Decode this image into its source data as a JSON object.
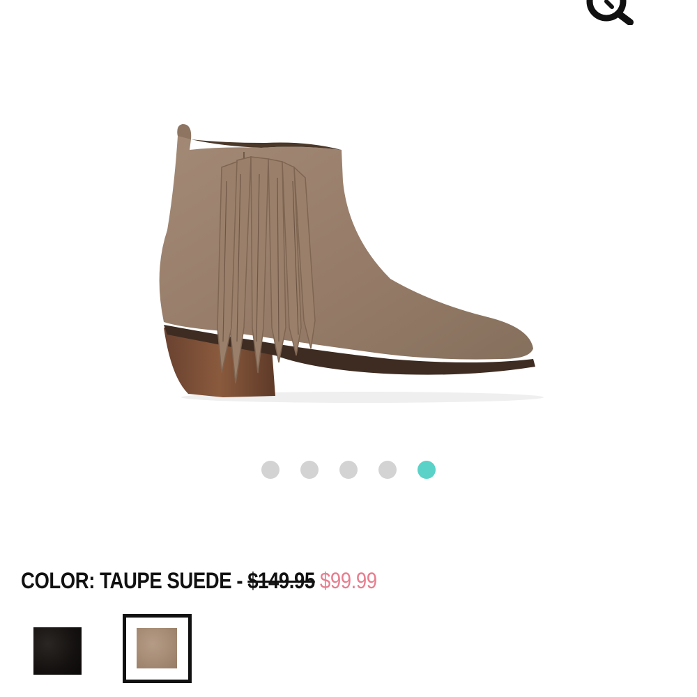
{
  "header": {
    "zoom_icon": "zoom-magnifier-icon"
  },
  "product": {
    "image_alt": "Taupe suede fringe ankle boot",
    "colors": {
      "suede": "#9c8370",
      "sole": "#4a352a",
      "heel": "#7a4e34"
    }
  },
  "carousel": {
    "dot_count": 5,
    "active_index": 4,
    "dot_color": "#d3d3d3",
    "active_color": "#5ad2c8"
  },
  "color_info": {
    "prefix": "COLOR: TAUPE SUEDE - ",
    "original_price": "$149.95",
    "sale_price": "$99.99",
    "sale_color": "#e87d8e"
  },
  "swatches": [
    {
      "name": "Black",
      "color": "#141110",
      "selected": false
    },
    {
      "name": "Taupe Suede",
      "color": "#a68b74",
      "selected": true
    }
  ]
}
